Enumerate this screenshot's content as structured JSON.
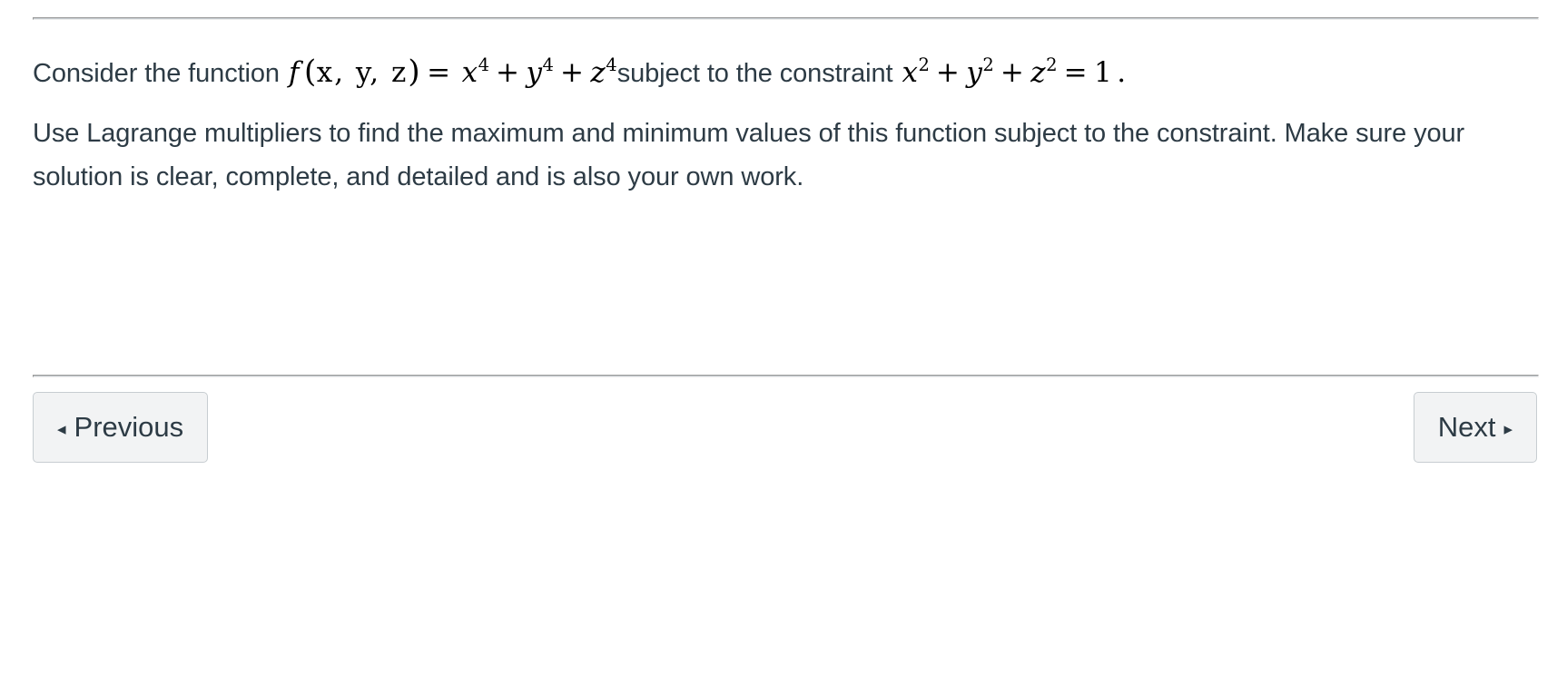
{
  "question": {
    "paragraph_1": {
      "lead_text": "Consider the function",
      "math_function": {
        "f": "f",
        "open_paren": "(",
        "vars": "x, y, z",
        "close_paren": ")",
        "equals": "=",
        "x_base": "x",
        "x_exp": "4",
        "plus_1": "+",
        "y_base": "y",
        "y_exp": "4",
        "plus_2": "+",
        "z_base": "z",
        "z_exp": "4"
      },
      "middle_text": "subject to the constraint",
      "math_constraint": {
        "x_base": "x",
        "x_exp": "2",
        "plus_1": "+",
        "y_base": "y",
        "y_exp": "2",
        "plus_2": "+",
        "z_base": "z",
        "z_exp": "2",
        "equals": "=",
        "value": "1",
        "period": "."
      }
    },
    "paragraph_2": "Use Lagrange multipliers to find the maximum and minimum values of this function subject to the constraint.  Make sure your solution is clear, complete, and detailed and is also your own work."
  },
  "navigation": {
    "previous_label": "Previous",
    "previous_arrow": "◂",
    "next_label": "Next",
    "next_arrow": "▸"
  },
  "colors": {
    "text": "#2d3b45",
    "rule": "#c7cdd1",
    "button_background": "#f2f3f4",
    "button_border": "#c7cdd1",
    "math_text": "#000000"
  }
}
